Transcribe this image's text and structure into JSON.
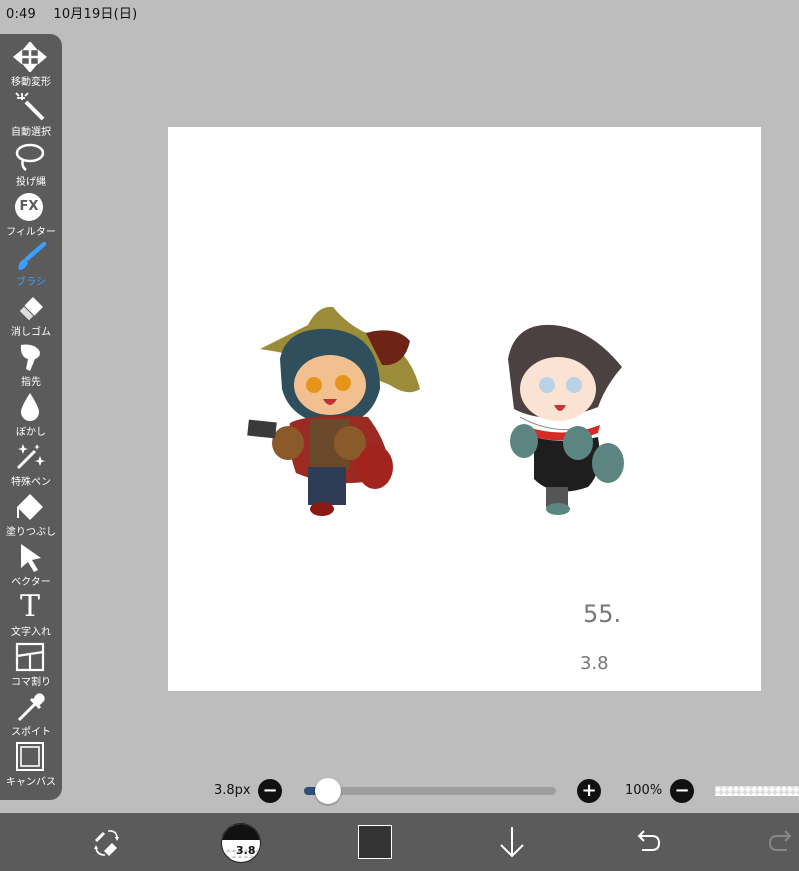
{
  "status": {
    "time": "0:49",
    "date": "10月19日(日)"
  },
  "tools": [
    {
      "label": "移動変形",
      "icon": "move-icon"
    },
    {
      "label": "自動選択",
      "icon": "magic-wand-icon"
    },
    {
      "label": "投げ縄",
      "icon": "lasso-icon"
    },
    {
      "label": "フィルター",
      "icon": "fx-icon",
      "text": "FX"
    },
    {
      "label": "ブラシ",
      "icon": "brush-icon"
    },
    {
      "label": "消しゴム",
      "icon": "eraser-icon"
    },
    {
      "label": "指先",
      "icon": "finger-icon"
    },
    {
      "label": "ぼかし",
      "icon": "blur-drop-icon"
    },
    {
      "label": "特殊ペン",
      "icon": "special-pen-icon"
    },
    {
      "label": "塗りつぶし",
      "icon": "fill-bucket-icon"
    },
    {
      "label": "ベクター",
      "icon": "vector-arrow-icon"
    },
    {
      "label": "文字入れ",
      "icon": "text-icon",
      "text": "T"
    },
    {
      "label": "コマ割り",
      "icon": "frame-divider-icon"
    },
    {
      "label": "スポイト",
      "icon": "eyedropper-icon"
    },
    {
      "label": "キャンバス",
      "icon": "canvas-icon"
    }
  ],
  "active_tool": "ブラシ",
  "canvas": {
    "annotation_top": "55.",
    "annotation_bottom": "3.8"
  },
  "size_bar": {
    "brush_size": "3.8px",
    "slider_fraction": 0.07,
    "opacity": "100%",
    "minus": "−",
    "plus": "+"
  },
  "bottom_bar": {
    "brush_preview_value": "3.8",
    "current_color": "#333333",
    "accent": "#3aa0ff"
  }
}
